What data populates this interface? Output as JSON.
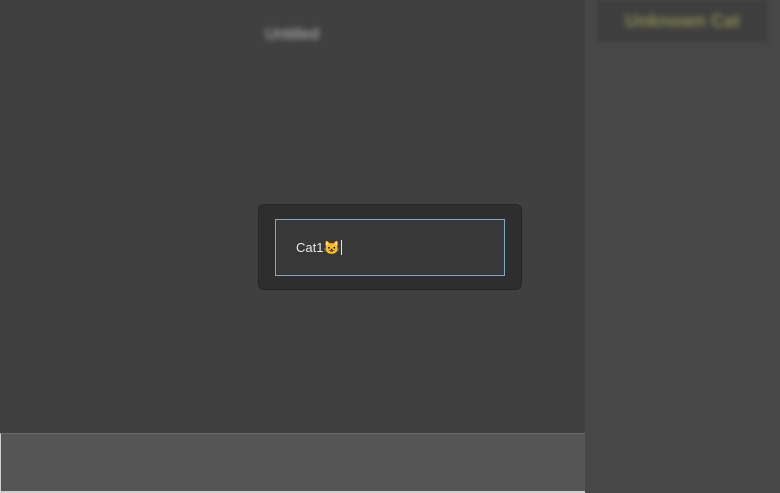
{
  "main": {
    "title": "Untitled"
  },
  "side_panel": {
    "title": "Unknown Cat"
  },
  "dialog": {
    "input_value": "Cat1😺"
  }
}
